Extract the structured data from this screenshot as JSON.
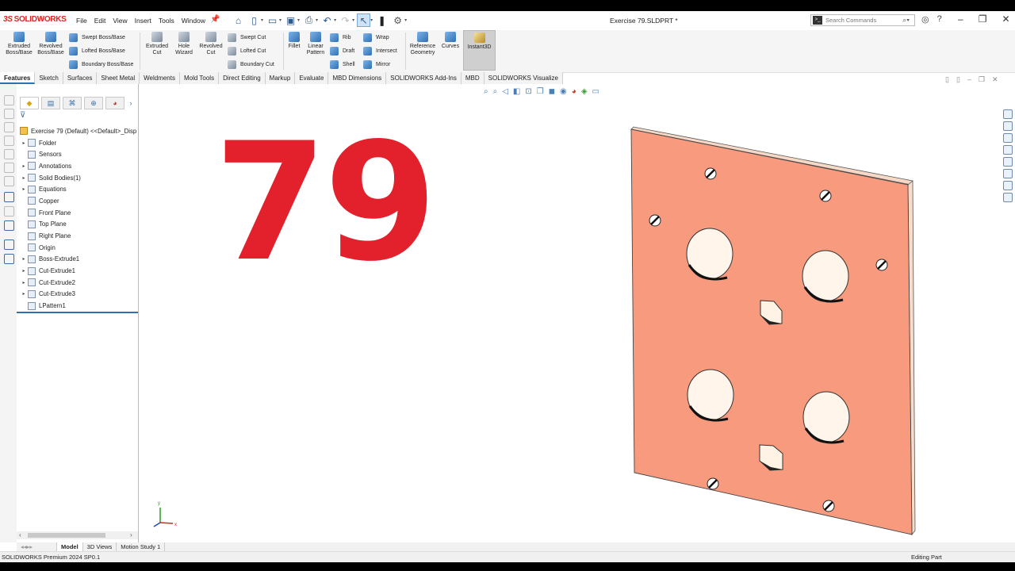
{
  "app": {
    "logo_prefix": "3S",
    "logo_text": "SOLIDWORKS",
    "document_title": "Exercise 79.SLDPRT *",
    "status_left": "SOLIDWORKS Premium 2024 SP0.1",
    "status_right": "Editing Part"
  },
  "menu": [
    "File",
    "Edit",
    "View",
    "Insert",
    "Tools",
    "Window"
  ],
  "search": {
    "placeholder": "Search Commands"
  },
  "ribbon": {
    "extruded_boss": "Extruded Boss/Base",
    "revolved_boss": "Revolved Boss/Base",
    "swept_boss": "Swept Boss/Base",
    "lofted_boss": "Lofted Boss/Base",
    "boundary_boss": "Boundary Boss/Base",
    "extruded_cut": "Extruded Cut",
    "hole_wizard": "Hole Wizard",
    "revolved_cut": "Revolved Cut",
    "swept_cut": "Swept Cut",
    "lofted_cut": "Lofted Cut",
    "boundary_cut": "Boundary Cut",
    "fillet": "Fillet",
    "linear_pattern": "Linear Pattern",
    "rib": "Rib",
    "draft": "Draft",
    "shell": "Shell",
    "wrap": "Wrap",
    "intersect": "Intersect",
    "mirror": "Mirror",
    "reference_geometry": "Reference Geometry",
    "curves": "Curves",
    "instant3d": "Instant3D"
  },
  "tabs": [
    "Features",
    "Sketch",
    "Surfaces",
    "Sheet Metal",
    "Weldments",
    "Mold Tools",
    "Direct Editing",
    "Markup",
    "Evaluate",
    "MBD Dimensions",
    "SOLIDWORKS Add-Ins",
    "MBD",
    "SOLIDWORKS Visualize"
  ],
  "tree": {
    "root": "Exercise 79 (Default) <<Default>_Disp",
    "items": [
      {
        "label": "Folder",
        "expandable": true
      },
      {
        "label": "Sensors",
        "expandable": false
      },
      {
        "label": "Annotations",
        "expandable": true
      },
      {
        "label": "Solid Bodies(1)",
        "expandable": true
      },
      {
        "label": "Equations",
        "expandable": true
      },
      {
        "label": "Copper",
        "expandable": false
      },
      {
        "label": "Front Plane",
        "expandable": false
      },
      {
        "label": "Top Plane",
        "expandable": false
      },
      {
        "label": "Right Plane",
        "expandable": false
      },
      {
        "label": "Origin",
        "expandable": false
      },
      {
        "label": "Boss-Extrude1",
        "expandable": true
      },
      {
        "label": "Cut-Extrude1",
        "expandable": true
      },
      {
        "label": "Cut-Extrude2",
        "expandable": true
      },
      {
        "label": "Cut-Extrude3",
        "expandable": true
      },
      {
        "label": "LPattern1",
        "expandable": false
      }
    ]
  },
  "viewport": {
    "exercise_number": "79"
  },
  "bottom_tabs": [
    "Model",
    "3D Views",
    "Motion Study 1"
  ],
  "colors": {
    "accent": "#2f6fb3",
    "part_face": "#f79a7e",
    "part_edge": "#f3d6c4",
    "number": "#e3212c"
  },
  "axes": {
    "x": "x",
    "y": "y"
  }
}
